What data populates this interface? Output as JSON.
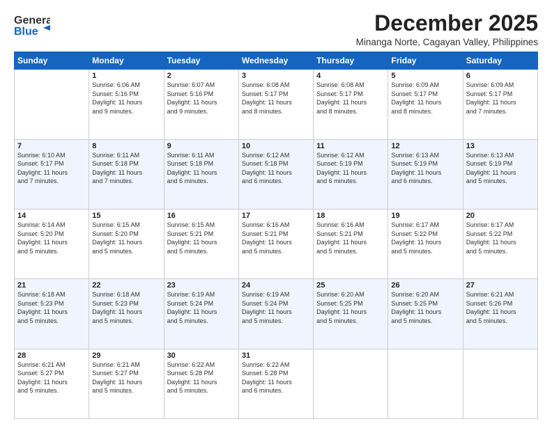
{
  "logo": {
    "line1": "General",
    "line2": "Blue"
  },
  "title": "December 2025",
  "subtitle": "Minanga Norte, Cagayan Valley, Philippines",
  "days_of_week": [
    "Sunday",
    "Monday",
    "Tuesday",
    "Wednesday",
    "Thursday",
    "Friday",
    "Saturday"
  ],
  "weeks": [
    [
      {
        "day": "",
        "sunrise": "",
        "sunset": "",
        "daylight": ""
      },
      {
        "day": "1",
        "sunrise": "Sunrise: 6:06 AM",
        "sunset": "Sunset: 5:16 PM",
        "daylight": "Daylight: 11 hours and 9 minutes."
      },
      {
        "day": "2",
        "sunrise": "Sunrise: 6:07 AM",
        "sunset": "Sunset: 5:16 PM",
        "daylight": "Daylight: 11 hours and 9 minutes."
      },
      {
        "day": "3",
        "sunrise": "Sunrise: 6:08 AM",
        "sunset": "Sunset: 5:17 PM",
        "daylight": "Daylight: 11 hours and 8 minutes."
      },
      {
        "day": "4",
        "sunrise": "Sunrise: 6:08 AM",
        "sunset": "Sunset: 5:17 PM",
        "daylight": "Daylight: 11 hours and 8 minutes."
      },
      {
        "day": "5",
        "sunrise": "Sunrise: 6:09 AM",
        "sunset": "Sunset: 5:17 PM",
        "daylight": "Daylight: 11 hours and 8 minutes."
      },
      {
        "day": "6",
        "sunrise": "Sunrise: 6:09 AM",
        "sunset": "Sunset: 5:17 PM",
        "daylight": "Daylight: 11 hours and 7 minutes."
      }
    ],
    [
      {
        "day": "7",
        "sunrise": "Sunrise: 6:10 AM",
        "sunset": "Sunset: 5:17 PM",
        "daylight": "Daylight: 11 hours and 7 minutes."
      },
      {
        "day": "8",
        "sunrise": "Sunrise: 6:11 AM",
        "sunset": "Sunset: 5:18 PM",
        "daylight": "Daylight: 11 hours and 7 minutes."
      },
      {
        "day": "9",
        "sunrise": "Sunrise: 6:11 AM",
        "sunset": "Sunset: 5:18 PM",
        "daylight": "Daylight: 11 hours and 6 minutes."
      },
      {
        "day": "10",
        "sunrise": "Sunrise: 6:12 AM",
        "sunset": "Sunset: 5:18 PM",
        "daylight": "Daylight: 11 hours and 6 minutes."
      },
      {
        "day": "11",
        "sunrise": "Sunrise: 6:12 AM",
        "sunset": "Sunset: 5:19 PM",
        "daylight": "Daylight: 11 hours and 6 minutes."
      },
      {
        "day": "12",
        "sunrise": "Sunrise: 6:13 AM",
        "sunset": "Sunset: 5:19 PM",
        "daylight": "Daylight: 11 hours and 6 minutes."
      },
      {
        "day": "13",
        "sunrise": "Sunrise: 6:13 AM",
        "sunset": "Sunset: 5:19 PM",
        "daylight": "Daylight: 11 hours and 5 minutes."
      }
    ],
    [
      {
        "day": "14",
        "sunrise": "Sunrise: 6:14 AM",
        "sunset": "Sunset: 5:20 PM",
        "daylight": "Daylight: 11 hours and 5 minutes."
      },
      {
        "day": "15",
        "sunrise": "Sunrise: 6:15 AM",
        "sunset": "Sunset: 5:20 PM",
        "daylight": "Daylight: 11 hours and 5 minutes."
      },
      {
        "day": "16",
        "sunrise": "Sunrise: 6:15 AM",
        "sunset": "Sunset: 5:21 PM",
        "daylight": "Daylight: 11 hours and 5 minutes."
      },
      {
        "day": "17",
        "sunrise": "Sunrise: 6:16 AM",
        "sunset": "Sunset: 5:21 PM",
        "daylight": "Daylight: 11 hours and 5 minutes."
      },
      {
        "day": "18",
        "sunrise": "Sunrise: 6:16 AM",
        "sunset": "Sunset: 5:21 PM",
        "daylight": "Daylight: 11 hours and 5 minutes."
      },
      {
        "day": "19",
        "sunrise": "Sunrise: 6:17 AM",
        "sunset": "Sunset: 5:22 PM",
        "daylight": "Daylight: 11 hours and 5 minutes."
      },
      {
        "day": "20",
        "sunrise": "Sunrise: 6:17 AM",
        "sunset": "Sunset: 5:22 PM",
        "daylight": "Daylight: 11 hours and 5 minutes."
      }
    ],
    [
      {
        "day": "21",
        "sunrise": "Sunrise: 6:18 AM",
        "sunset": "Sunset: 5:23 PM",
        "daylight": "Daylight: 11 hours and 5 minutes."
      },
      {
        "day": "22",
        "sunrise": "Sunrise: 6:18 AM",
        "sunset": "Sunset: 5:23 PM",
        "daylight": "Daylight: 11 hours and 5 minutes."
      },
      {
        "day": "23",
        "sunrise": "Sunrise: 6:19 AM",
        "sunset": "Sunset: 5:24 PM",
        "daylight": "Daylight: 11 hours and 5 minutes."
      },
      {
        "day": "24",
        "sunrise": "Sunrise: 6:19 AM",
        "sunset": "Sunset: 5:24 PM",
        "daylight": "Daylight: 11 hours and 5 minutes."
      },
      {
        "day": "25",
        "sunrise": "Sunrise: 6:20 AM",
        "sunset": "Sunset: 5:25 PM",
        "daylight": "Daylight: 11 hours and 5 minutes."
      },
      {
        "day": "26",
        "sunrise": "Sunrise: 6:20 AM",
        "sunset": "Sunset: 5:25 PM",
        "daylight": "Daylight: 11 hours and 5 minutes."
      },
      {
        "day": "27",
        "sunrise": "Sunrise: 6:21 AM",
        "sunset": "Sunset: 5:26 PM",
        "daylight": "Daylight: 11 hours and 5 minutes."
      }
    ],
    [
      {
        "day": "28",
        "sunrise": "Sunrise: 6:21 AM",
        "sunset": "Sunset: 5:27 PM",
        "daylight": "Daylight: 11 hours and 5 minutes."
      },
      {
        "day": "29",
        "sunrise": "Sunrise: 6:21 AM",
        "sunset": "Sunset: 5:27 PM",
        "daylight": "Daylight: 11 hours and 5 minutes."
      },
      {
        "day": "30",
        "sunrise": "Sunrise: 6:22 AM",
        "sunset": "Sunset: 5:28 PM",
        "daylight": "Daylight: 11 hours and 5 minutes."
      },
      {
        "day": "31",
        "sunrise": "Sunrise: 6:22 AM",
        "sunset": "Sunset: 5:28 PM",
        "daylight": "Daylight: 11 hours and 6 minutes."
      },
      {
        "day": "",
        "sunrise": "",
        "sunset": "",
        "daylight": ""
      },
      {
        "day": "",
        "sunrise": "",
        "sunset": "",
        "daylight": ""
      },
      {
        "day": "",
        "sunrise": "",
        "sunset": "",
        "daylight": ""
      }
    ]
  ]
}
